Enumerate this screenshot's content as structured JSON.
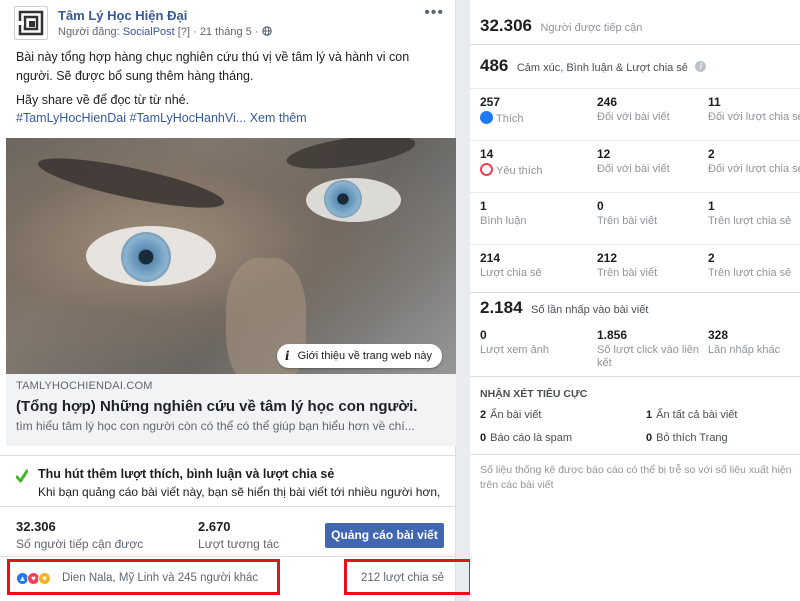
{
  "post": {
    "page_name": "Tâm Lý Học Hiện Đại",
    "posted_by_label": "Người đăng:",
    "posted_by": "SocialPost",
    "help_mark": "[?]",
    "date": "21 tháng 5",
    "privacy_icon": "globe-icon",
    "text_lines": [
      "Bài này tổng hợp hàng chục nghiên cứu thú vị về tâm lý và hành vi con người. Sẽ được bổ sung thêm hàng tháng.",
      "Hãy share về để đọc từ từ nhé."
    ],
    "hashtags": "#TamLyHocHienDai #TamLyHocHanhVi...",
    "see_more": "Xem thêm",
    "site_intro": "Giới thiệu về trang web này",
    "link": {
      "domain": "TAMLYHOCHIENDAI.COM",
      "title": "(Tổng hợp) Những nghiên cứu về tâm lý học con người.",
      "description": "tìm hiểu tâm lý học con người còn có thể có thể giúp bạn hiểu hơn về chí..."
    },
    "promo": {
      "title": "Thu hút thêm lượt thích, bình luận và lượt chia sẻ",
      "description": "Khi bạn quảng cáo bài viết này, bạn sẽ hiển thị bài viết tới nhiều người hơn,"
    },
    "stats": {
      "reach_value": "32.306",
      "reach_label": "Số người tiếp cận được",
      "engagement_value": "2.670",
      "engagement_label": "Lượt tương tác"
    },
    "boost_button": "Quảng cáo bài viết",
    "reactions_text": "Dien Nala, Mỹ Linh và 245 người khác",
    "shares_text": "212 lượt chia sẻ",
    "highlight_color": "#e3121b"
  },
  "insights": {
    "reach_value": "32.306",
    "reach_label": "Người được tiếp cận",
    "engagement_value": "486",
    "engagement_label": "Cảm xúc, Bình luận & Lượt chia sẻ",
    "rows": [
      [
        {
          "num": "257",
          "label": "Thích",
          "icon": "like-icon"
        },
        {
          "num": "246",
          "label": "Đối với bài viết"
        },
        {
          "num": "11",
          "label": "Đối với lượt chia sẻ"
        }
      ],
      [
        {
          "num": "14",
          "label": "Yêu thích",
          "icon": "love-icon"
        },
        {
          "num": "12",
          "label": "Đối với bài viết"
        },
        {
          "num": "2",
          "label": "Đối với lượt chia sẻ"
        }
      ],
      [
        {
          "num": "1",
          "label": "Bình luận"
        },
        {
          "num": "0",
          "label": "Trên bài viết"
        },
        {
          "num": "1",
          "label": "Trên lượt chia sẻ"
        }
      ],
      [
        {
          "num": "214",
          "label": "Lượt chia sẻ"
        },
        {
          "num": "212",
          "label": "Trên bài viết"
        },
        {
          "num": "2",
          "label": "Trên lượt chia sẻ"
        }
      ]
    ],
    "clicks_value": "2.184",
    "clicks_label": "Số lần nhấp vào bài viết",
    "click_cells": [
      {
        "num": "0",
        "label": "Lượt xem ảnh"
      },
      {
        "num": "1.856",
        "label": "Số lượt click vào liên kết"
      },
      {
        "num": "328",
        "label": "Lần nhấp khác"
      }
    ],
    "negative_title": "NHẬN XÉT TIÊU CỰC",
    "negative": [
      {
        "num": "2",
        "label": "Ẩn bài viết"
      },
      {
        "num": "1",
        "label": "Ẩn tất cả bài viết"
      },
      {
        "num": "0",
        "label": "Báo cáo là spam"
      },
      {
        "num": "0",
        "label": "Bỏ thích Trang"
      }
    ],
    "footnote": "Số liệu thống kê được báo cáo có thể bị trễ so với số liệu xuất hiện trên các bài viết"
  }
}
